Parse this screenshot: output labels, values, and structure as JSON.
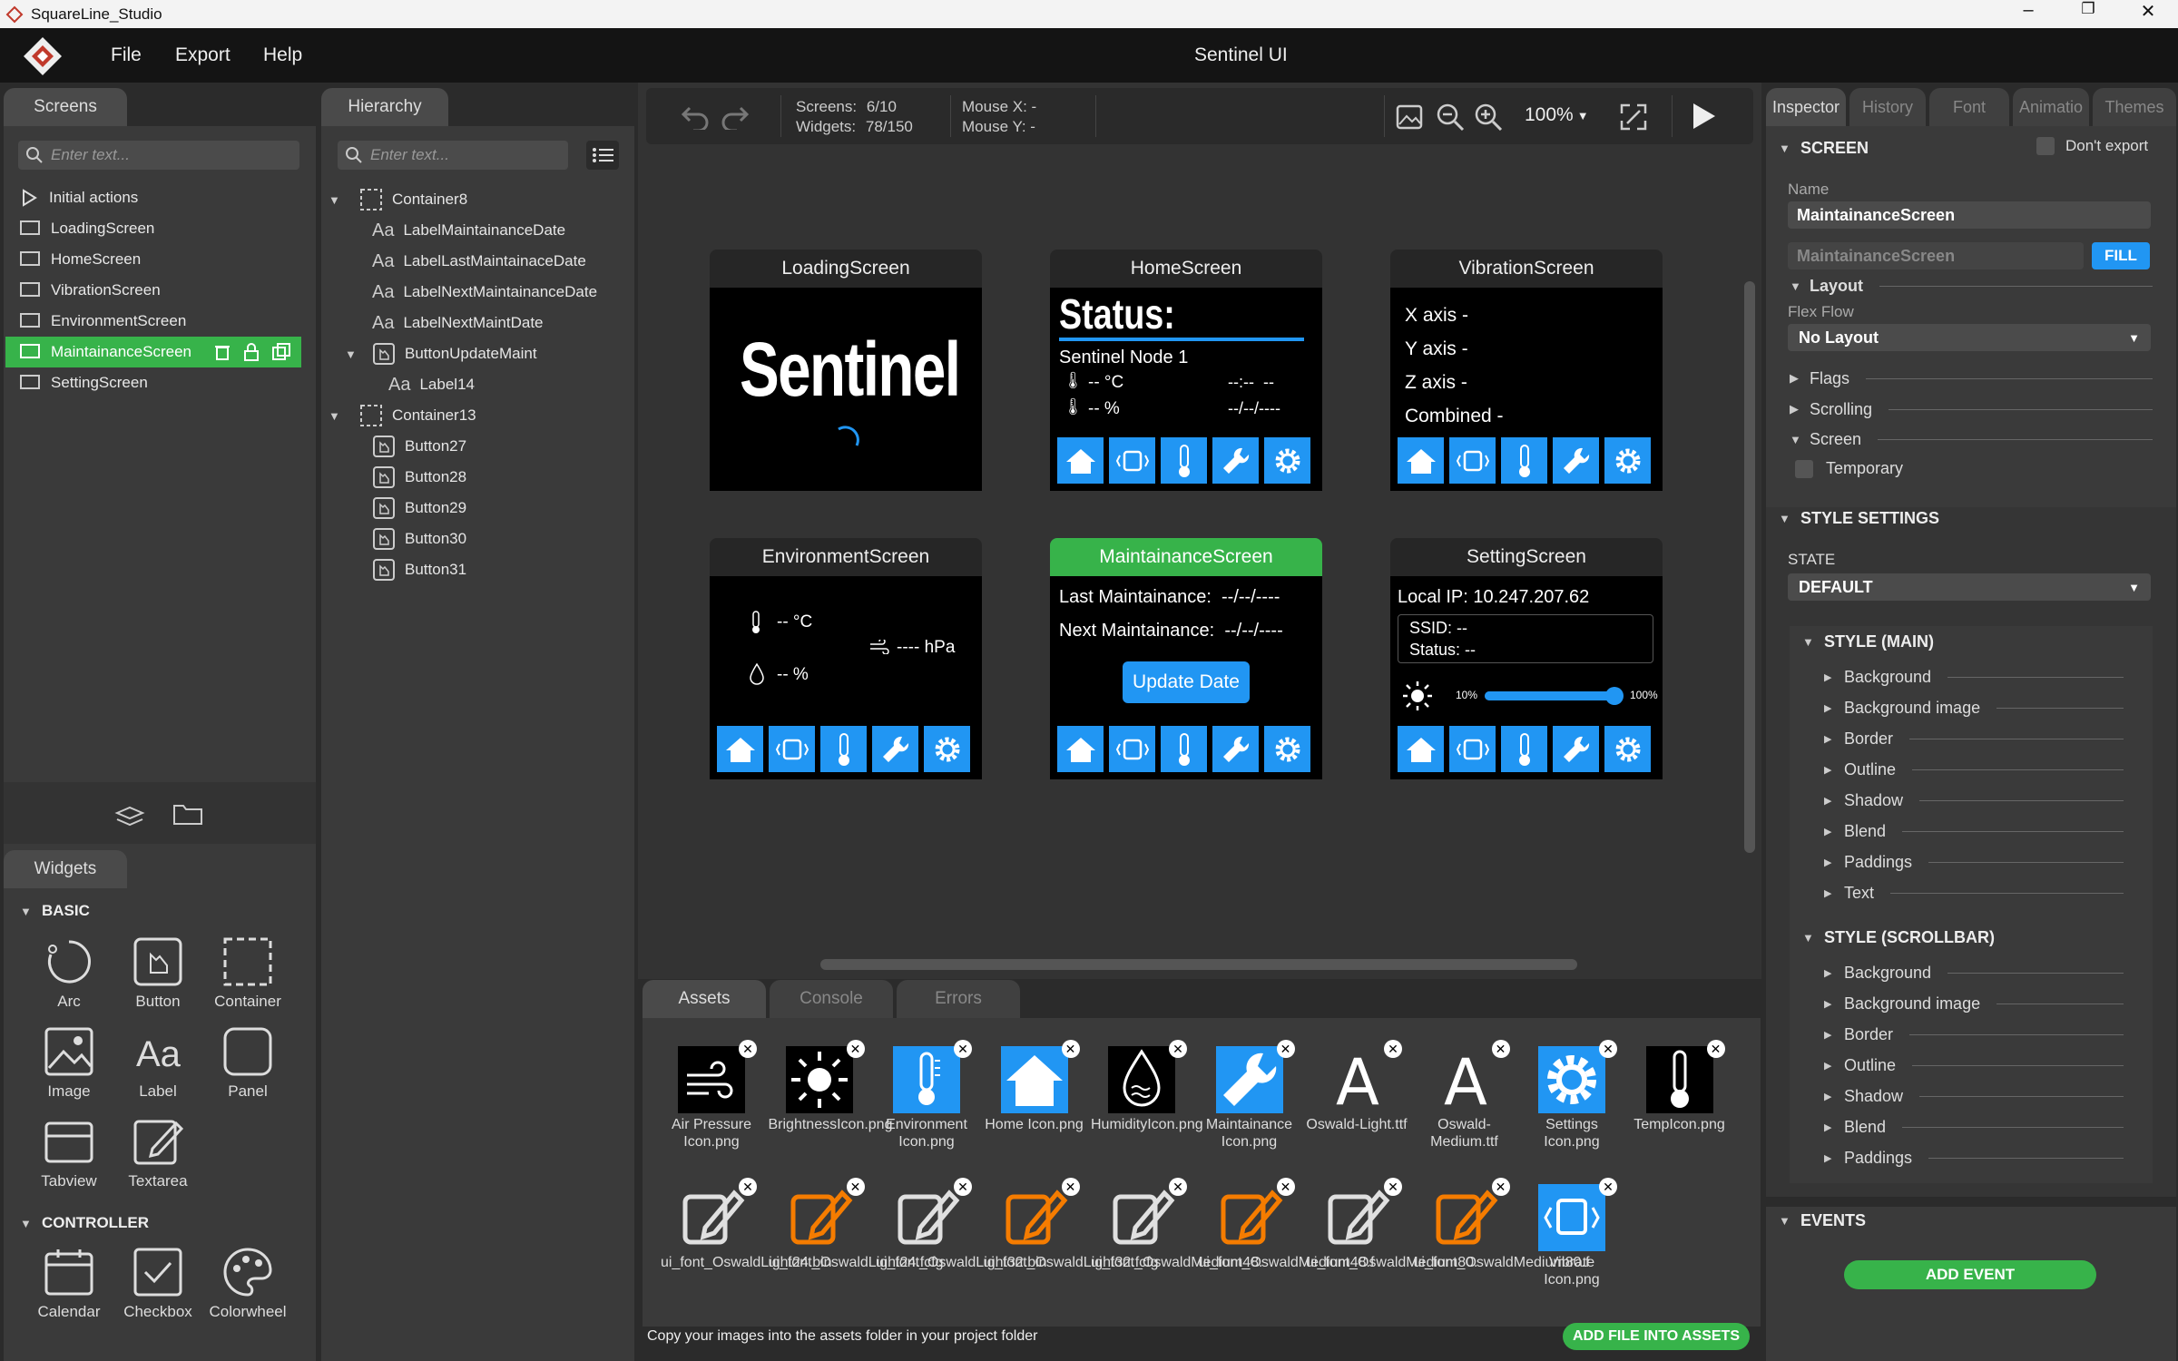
{
  "window": {
    "title": "SquareLine_Studio",
    "project": "Sentinel UI",
    "controls": [
      "minimize",
      "maximize",
      "close"
    ]
  },
  "menu": [
    "File",
    "Export",
    "Help"
  ],
  "screens_panel": {
    "tab": "Screens",
    "placeholder": "Enter text...",
    "items": [
      "Initial actions",
      "LoadingScreen",
      "HomeScreen",
      "VibrationScreen",
      "EnvironmentScreen",
      "MaintainanceScreen",
      "SettingScreen"
    ],
    "selected": "MaintainanceScreen"
  },
  "hierarchy": {
    "tab": "Hierarchy",
    "placeholder": "Enter text...",
    "items": [
      "Container8",
      "LabelMaintainanceDate",
      "LabelLastMaintainaceDate",
      "LabelNextMaintainanceDate",
      "LabelNextMaintDate",
      "ButtonUpdateMaint",
      "Label14",
      "Container13",
      "Button27",
      "Button28",
      "Button29",
      "Button30",
      "Button31"
    ]
  },
  "widgets": {
    "tab": "Widgets",
    "basic_title": "BASIC",
    "basic": [
      "Arc",
      "Button",
      "Container",
      "Image",
      "Label",
      "Panel",
      "Tabview",
      "Textarea"
    ],
    "controller_title": "CONTROLLER",
    "controller": [
      "Calendar",
      "Checkbox",
      "Colorwheel"
    ]
  },
  "toolbar": {
    "screens_label": "Screens:",
    "screens_value": "6/10",
    "widgets_label": "Widgets:",
    "widgets_value": "78/150",
    "mouse_x": "Mouse X: -",
    "mouse_y": "Mouse Y: -",
    "zoom": "100%"
  },
  "canvas": {
    "loading": {
      "title": "LoadingScreen",
      "text": "Sentinel"
    },
    "home": {
      "title": "HomeScreen",
      "status": "Status:",
      "node": "Sentinel Node 1",
      "temp": "-- °C",
      "hum": "-- %",
      "time": "--:--  --",
      "date": "--/--/----"
    },
    "vibration": {
      "title": "VibrationScreen",
      "lines": [
        "X axis -",
        "Y axis -",
        "Z axis -",
        "Combined -"
      ]
    },
    "environment": {
      "title": "EnvironmentScreen",
      "temp": "-- °C",
      "hum": "-- %",
      "pressure": "---- hPa"
    },
    "maintainance": {
      "title": "MaintainanceScreen",
      "last": "Last Maintainance:",
      "last_val": "--/--/----",
      "next": "Next Maintainance:",
      "next_val": "--/--/----",
      "button": "Update Date"
    },
    "setting": {
      "title": "SettingScreen",
      "ip": "Local IP: 10.247.207.62",
      "ssid": "SSID: --",
      "status": "Status: --",
      "min": "10%",
      "max": "100%",
      "slider_level": 0.95
    }
  },
  "bottom": {
    "tabs": [
      "Assets",
      "Console",
      "Errors"
    ],
    "hint": "Copy your images into the assets folder in your project folder",
    "add_button": "ADD FILE INTO ASSETS",
    "assets_row1": [
      "Air Pressure Icon.png",
      "BrightnessIcon.png",
      "Environment Icon.png",
      "Home Icon.png",
      "HumidityIcon.png",
      "Maintainance Icon.png",
      "Oswald-Light.ttf",
      "Oswald-Medium.ttf",
      "Settings Icon.png",
      "TempIcon.png"
    ],
    "assets_row2": [
      "ui_font_OswaldLight24.bin",
      "ui_font_OswaldLight24.fcfg",
      "ui_font_OswaldLight32.bin",
      "ui_font_OswaldLight32.fcfg",
      "ui_font_OswaldMedium48.",
      "ui_font_OswaldMedium48.f",
      "ui_font_OswaldMedium80.",
      "ui_font_OswaldMedium80.f",
      "Vibrate Icon.png"
    ]
  },
  "inspector": {
    "tabs": [
      "Inspector",
      "History",
      "Font",
      "Animatio",
      "Themes"
    ],
    "screen_section": "SCREEN",
    "dont_export": "Don't export",
    "name_label": "Name",
    "name_value": "MaintainanceScreen",
    "name_placeholder": "MaintainanceScreen",
    "fill": "FILL",
    "layout": "Layout",
    "flex_flow": "Flex Flow",
    "no_layout": "No Layout",
    "flags": "Flags",
    "scrolling": "Scrolling",
    "screen": "Screen",
    "temporary": "Temporary",
    "style_settings": "STYLE SETTINGS",
    "state": "STATE",
    "state_value": "DEFAULT",
    "style_main": "STYLE (MAIN)",
    "main_props": [
      "Background",
      "Background image",
      "Border",
      "Outline",
      "Shadow",
      "Blend",
      "Paddings",
      "Text"
    ],
    "style_scrollbar": "STYLE (SCROLLBAR)",
    "scroll_props": [
      "Background",
      "Background image",
      "Border",
      "Outline",
      "Shadow",
      "Blend",
      "Paddings"
    ],
    "events": "EVENTS",
    "add_event": "ADD EVENT"
  }
}
